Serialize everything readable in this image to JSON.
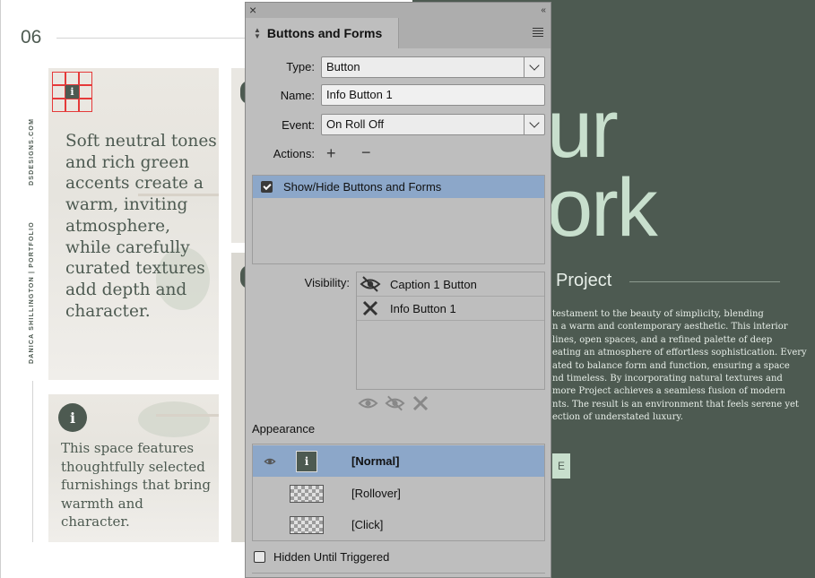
{
  "layout_page": {
    "page_number": "06",
    "vertical_site": "DSDESIGNS.COM",
    "vertical_credit": "DANICA SHILLINGTON | PORTFOLIO",
    "card1_text": "Soft neutral tones and rich green accents create a warm, inviting atmosphere, while carefully curated textures add depth and character.",
    "card2_text": "This space features thoughtfully selected furnishings that bring warmth and character.",
    "info_glyph": "i"
  },
  "dark_page": {
    "heading_line1": "ur",
    "heading_line2": "ork",
    "project_title": "Project",
    "body_lines": [
      "testament to the beauty of simplicity, blending",
      "n a warm and contemporary aesthetic. This interior",
      "lines, open spaces, and a refined palette of deep",
      "eating an atmosphere of effortless sophistication. Every",
      "ated to balance form and function, ensuring a space",
      "nd timeless. By incorporating natural textures and",
      "more Project achieves a seamless fusion of modern",
      "nts. The result is an environment that feels serene yet",
      "ection of understated luxury."
    ],
    "button_stub": "E"
  },
  "panel": {
    "close_glyph": "×",
    "collapse_glyph": "‹‹",
    "tab_label": "Buttons and Forms",
    "type_label": "Type:",
    "type_value": "Button",
    "name_label": "Name:",
    "name_value": "Info Button 1",
    "event_label": "Event:",
    "event_value": "On Roll Off",
    "actions_label": "Actions:",
    "action_items": [
      "Show/Hide Buttons and Forms"
    ],
    "visibility_label": "Visibility:",
    "visibility_items": [
      {
        "label": "Caption 1 Button",
        "state": "hide"
      },
      {
        "label": "Info Button 1",
        "state": "ignore"
      }
    ],
    "appearance_label": "Appearance",
    "states": [
      "[Normal]",
      "[Rollover]",
      "[Click]"
    ],
    "hidden_until_triggered_label": "Hidden Until Triggered",
    "colors": {
      "selection": "#8ca7c9",
      "panel_bg": "#bebebe",
      "accent_green": "#4d5a51",
      "mint": "#c8dfcd"
    }
  }
}
